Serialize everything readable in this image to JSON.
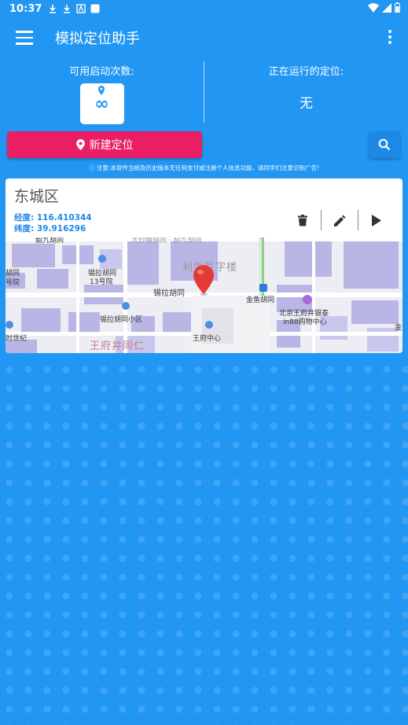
{
  "status_bar": {
    "time": "10:37"
  },
  "app_bar": {
    "title": "模拟定位助手"
  },
  "info": {
    "launch_label": "可用启动次数:",
    "launch_value": "∞",
    "running_label": "正在运行的定位:",
    "running_value": "无"
  },
  "actions": {
    "new_location": "新建定位"
  },
  "notice": "注意:本软件当前及历史版本无任何支付或注册个人信息功能，请同学们注意识别广告!",
  "card": {
    "title": "东城区",
    "lng_label": "经度:",
    "lng_value": "116.410344",
    "lat_label": "纬度:",
    "lat_value": "39.916296"
  },
  "map_labels": {
    "top_street": "韶九胡同",
    "top_street2": "大纱帽胡同 · 韶九胡同",
    "building": "利生写字楼",
    "left1": "胡同",
    "left2": "号院",
    "xila1": "锡拉胡同",
    "xila2": "13号院",
    "xila_street": "锡拉胡同",
    "jinyu": "金鱼胡同",
    "xila_xq": "锡拉胡同小区",
    "bj1": "北京王府井银泰",
    "bj2": "in88购物中心",
    "wfj": "王府井同仁",
    "wfj_center": "王府中心",
    "century": "时世纪",
    "right_edge": "金"
  }
}
